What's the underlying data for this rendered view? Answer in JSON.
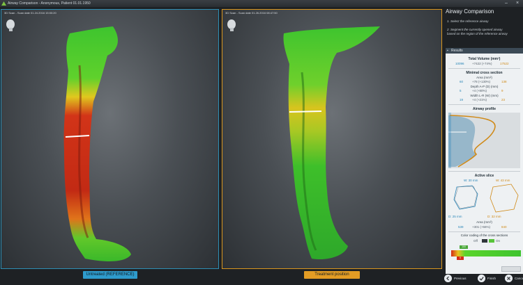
{
  "window": {
    "title": "Airway Comparison - Anonymous, Patient 01.01.1950",
    "accent": "#2e8fb5"
  },
  "viewports": {
    "left": {
      "header": "3D Scan - Scan date 01.24.2016 15:00:20",
      "label": "Untreated (REFERENCE)",
      "color": "#2e9bcc"
    },
    "right": {
      "header": "3D Scan - Scan date 01.26.2016 08:47:50",
      "label": "Treatment position",
      "color": "#e39c24"
    }
  },
  "panel": {
    "title": "Airway Comparison",
    "step1": "1. Select the reference airway",
    "step2a": "2. Segment the currently opened airway",
    "step2b": "based on the region of the reference airway",
    "results_label": "Results",
    "total_volume": {
      "label": "Total Volume (mm³)",
      "ref": "10096",
      "diff": "+7422 (+74%)",
      "cur": "17522"
    },
    "min_cross": {
      "label": "Minimal cross section",
      "area_label": "Area (mm²)",
      "area_ref": "60",
      "area_diff": "+78 (+130%)",
      "area_cur": "138",
      "depth_label": "Depth A-P (D) (mm)",
      "depth_ref": "5",
      "depth_diff": "+4 (+80%)",
      "depth_cur": "9",
      "width_label": "Width L-R (W) (mm)",
      "width_ref": "19",
      "width_diff": "+4 (+21%)",
      "width_cur": "23"
    },
    "profile_label": "Airway profile",
    "active_slice": {
      "label": "Active slice",
      "w_left": "W: 30 mm",
      "w_right": "W: 43 mm",
      "d_left": "D: 25 mm",
      "d_right": "D: 32 mm",
      "area_label": "Area (mm²)",
      "area_ref": "539",
      "area_diff": "+301 (+56%)",
      "area_cur": "840"
    },
    "color_coding": {
      "label": "Color coding of the cross sections",
      "off": "Off",
      "on": "On",
      "marker_top": "100",
      "marker_bottom": "0"
    }
  },
  "buttons": {
    "previous": "Previous",
    "finish": "Finish",
    "cancel": "Cancel"
  }
}
